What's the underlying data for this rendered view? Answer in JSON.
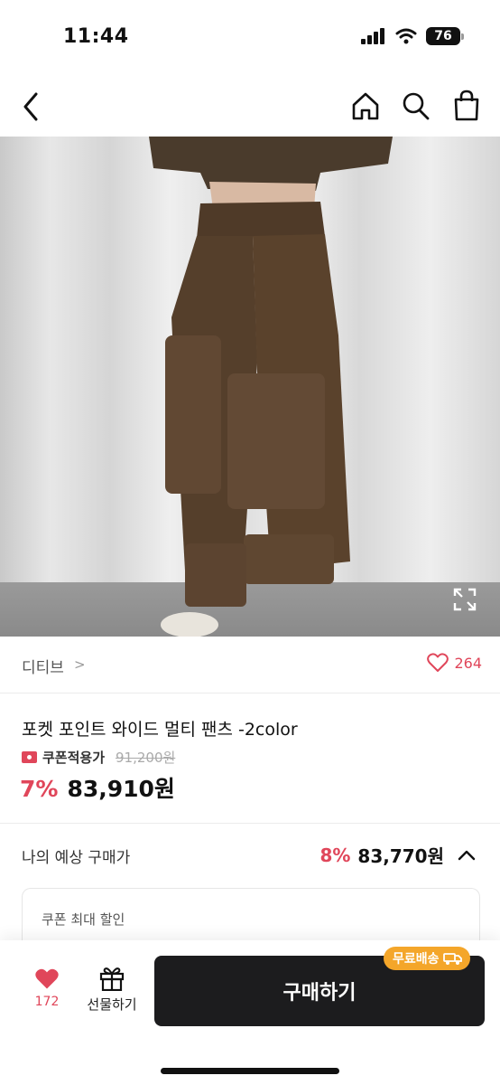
{
  "status_bar": {
    "time": "11:44",
    "battery": "76"
  },
  "nav": {
    "back_icon": "chevron-left-icon",
    "icons": [
      "home-icon",
      "search-icon",
      "shopping-bag-icon"
    ]
  },
  "product": {
    "brand": "디티브",
    "brand_chevron": ">",
    "like_count": "264",
    "title": "포켓 포인트 와이드 멀티 팬츠 -2color",
    "coupon_label": "쿠폰적용가",
    "original_price": "91,200원",
    "discount": "7%",
    "price": "83,910원"
  },
  "estimate": {
    "label": "나의 예상 구매가",
    "discount": "8%",
    "price": "83,770원",
    "toggle_icon": "chevron-up-icon",
    "coupon_box_label": "쿠폰 최대 할인"
  },
  "bottom_bar": {
    "like_count": "172",
    "gift_label": "선물하기",
    "buy_label": "구매하기",
    "shipping_badge": "무료배송"
  },
  "colors": {
    "accent": "#e0465a",
    "button": "#1c1c1e",
    "badge": "#f4a62a"
  }
}
